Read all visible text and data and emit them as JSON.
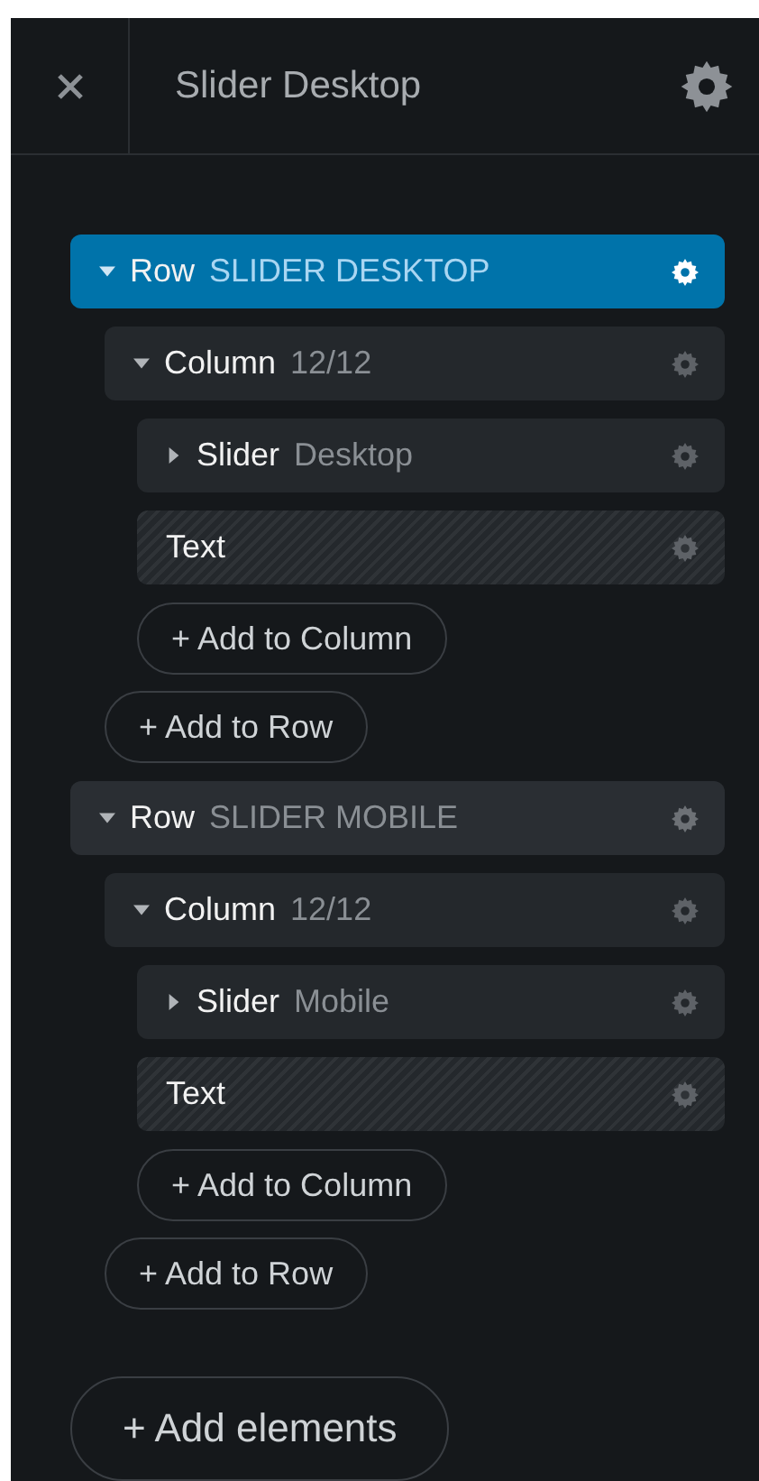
{
  "header": {
    "title": "Slider Desktop"
  },
  "rows": [
    {
      "label": "Row",
      "name": "SLIDER DESKTOP",
      "selected": true,
      "expanded": true,
      "columns": [
        {
          "label": "Column",
          "name": "12/12",
          "expanded": true,
          "elements": [
            {
              "kind": "slider",
              "label": "Slider",
              "name": "Desktop",
              "expanded": false
            },
            {
              "kind": "text",
              "label": "Text"
            }
          ],
          "add": "+ Add to Column"
        }
      ],
      "add": "+ Add to Row"
    },
    {
      "label": "Row",
      "name": "SLIDER MOBILE",
      "selected": false,
      "expanded": true,
      "columns": [
        {
          "label": "Column",
          "name": "12/12",
          "expanded": true,
          "elements": [
            {
              "kind": "slider",
              "label": "Slider",
              "name": "Mobile",
              "expanded": false
            },
            {
              "kind": "text",
              "label": "Text"
            }
          ],
          "add": "+ Add to Column"
        }
      ],
      "add": "+ Add to Row"
    }
  ],
  "add_elements": "+ Add elements"
}
